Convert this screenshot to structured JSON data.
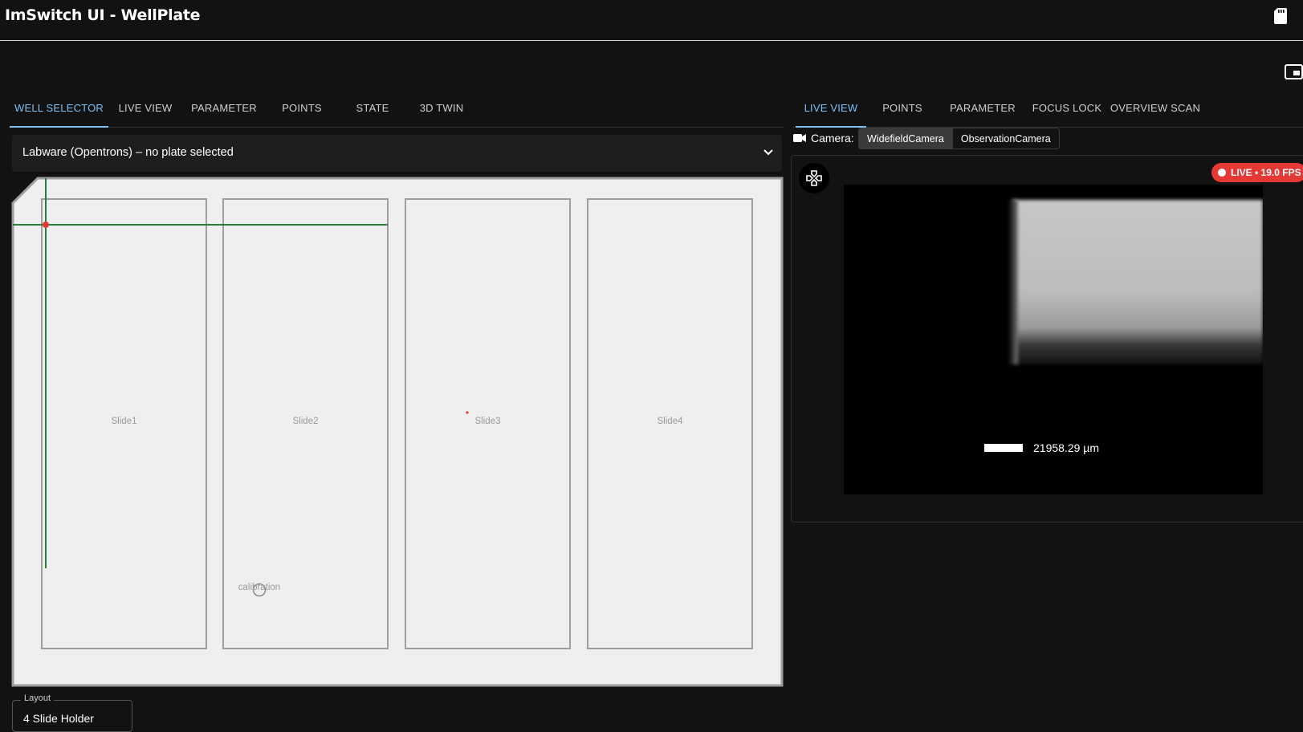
{
  "app": {
    "title": "ImSwitch UI - WellPlate"
  },
  "left_tabs": [
    {
      "label": "WELL SELECTOR",
      "active": true
    },
    {
      "label": "LIVE VIEW",
      "active": false
    },
    {
      "label": "PARAMETER",
      "active": false
    },
    {
      "label": "POINTS",
      "active": false
    },
    {
      "label": "STATE",
      "active": false
    },
    {
      "label": "3D TWIN",
      "active": false
    }
  ],
  "right_tabs": [
    {
      "label": "LIVE VIEW",
      "active": true
    },
    {
      "label": "POINTS",
      "active": false
    },
    {
      "label": "PARAMETER",
      "active": false
    },
    {
      "label": "FOCUS LOCK",
      "active": false
    },
    {
      "label": "OVERVIEW SCAN",
      "active": false
    }
  ],
  "labware": {
    "title": "Labware (Opentrons) – no plate selected"
  },
  "plate": {
    "slides": [
      "Slide1",
      "Slide2",
      "Slide3",
      "Slide4"
    ],
    "calibration_label": "calibration"
  },
  "layout_field": {
    "legend": "Layout",
    "value": "4 Slide Holder"
  },
  "camera": {
    "label": "Camera:",
    "options": [
      "WidefieldCamera",
      "ObservationCamera"
    ],
    "selected": "WidefieldCamera"
  },
  "live": {
    "badge": "LIVE • 19.0 FPS",
    "scale_bar_text": "21958.29 µm"
  },
  "icons": {
    "app_bar": "sd-card-icon",
    "window": "picture-in-picture-icon",
    "camera": "videocam-icon",
    "joystick": "gamepad-icon",
    "expand": "chevron-down-icon"
  },
  "colors": {
    "accent": "#7cc0f5",
    "live_badge": "#e53935",
    "crosshair": "#2e7d32",
    "position_marker": "#e53935"
  }
}
